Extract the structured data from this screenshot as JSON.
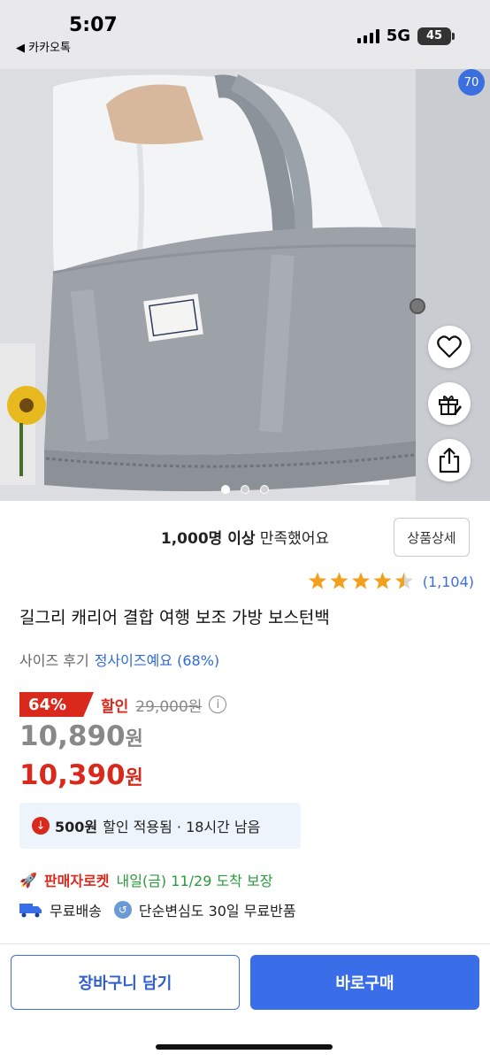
{
  "status_bar": {
    "time": "5:07",
    "back_app": "◀ 카카오톡",
    "network": "5G",
    "battery": "45"
  },
  "gallery": {
    "image_counter": "70",
    "dots_total": 3,
    "dots_active_index": 0
  },
  "actions": {
    "wishlist_icon": "heart-icon",
    "gift_icon": "gift-icon",
    "share_icon": "share-icon"
  },
  "product": {
    "satisfaction_bold": "1,000명 이상",
    "satisfaction_rest": " 만족했어요",
    "detail_button": "상품상세",
    "rating": 4.5,
    "review_count": "(1,104)",
    "title": "길그리 캐리어 결합 여행 보조 가방 보스턴백",
    "size_review_label": "사이즈 후기",
    "size_review_value": "정사이즈예요 (68%)"
  },
  "pricing": {
    "discount_badge": "64%",
    "discount_label": "할인",
    "original_price": "29,000원",
    "info_icon": "i",
    "price_sale_amount": "10,890",
    "price_sale_unit": "원",
    "price_final_amount": "10,390",
    "price_final_unit": "원"
  },
  "coupon": {
    "amount": "500원",
    "text": "할인 적용됨 · 18시간 남음"
  },
  "delivery": {
    "rocket_label": "판매자로켓",
    "arrival": "내일(금) 11/29 도착 보장",
    "free_shipping": "무료배송",
    "free_return": "단순변심도 30일 무료반품"
  },
  "bottom_bar": {
    "cart_button": "장바구니 담기",
    "buy_button": "바로구매"
  },
  "colors": {
    "accent_blue": "#3a6ee8",
    "sale_red": "#d9291c",
    "delivery_green": "#2a9a3c",
    "star_orange": "#f2a11e"
  }
}
